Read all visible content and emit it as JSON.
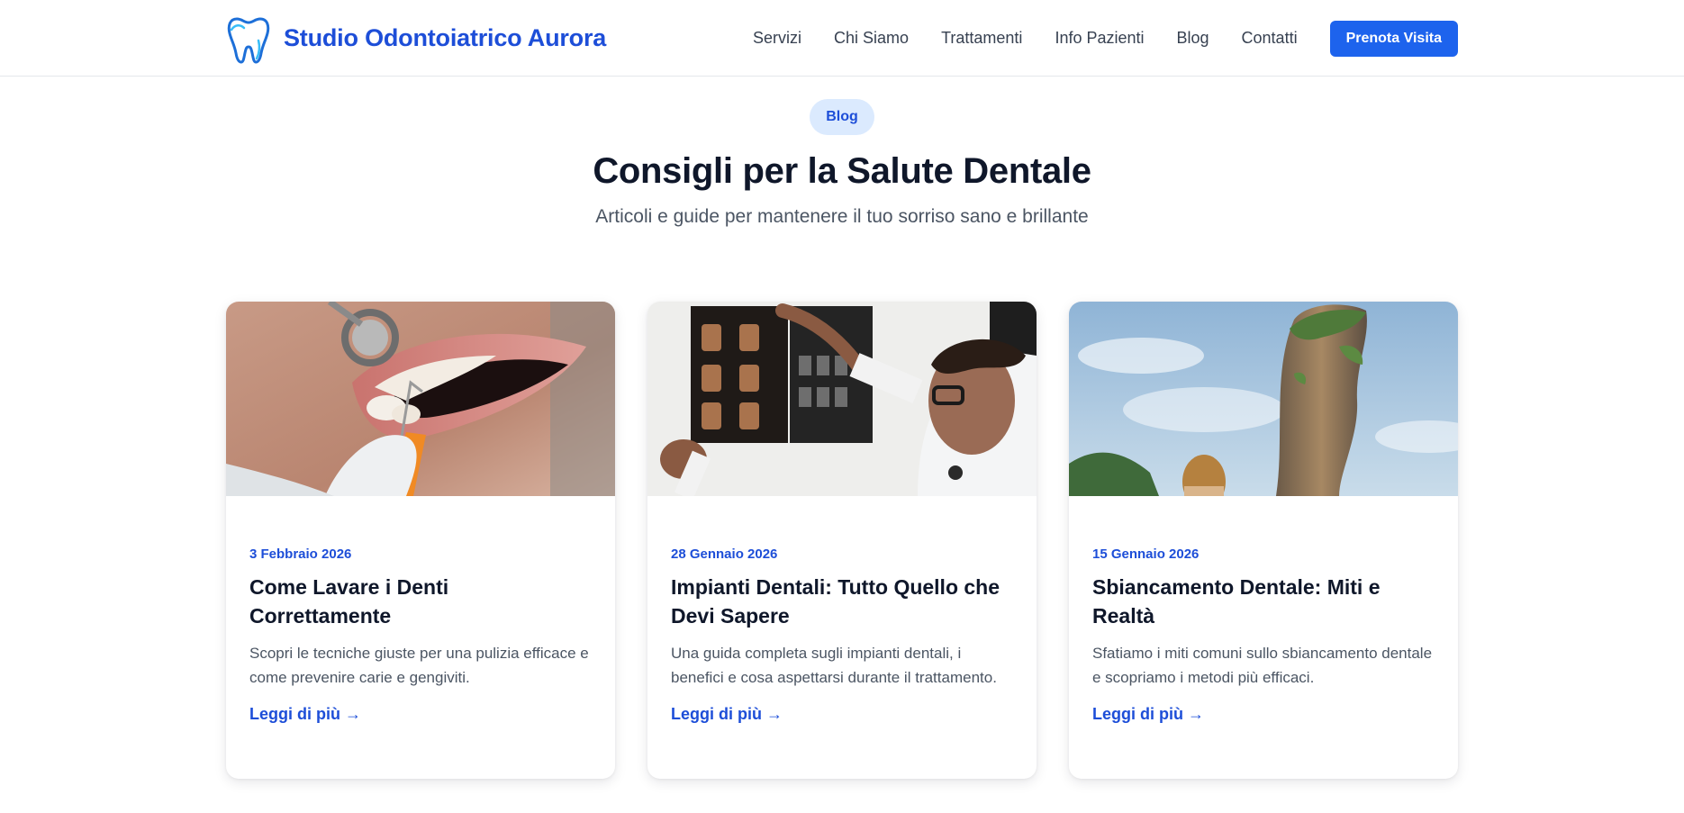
{
  "header": {
    "brand_name": "Studio Odontoiatrico Aurora",
    "logo_icon": "tooth-icon",
    "nav": [
      {
        "label": "Servizi"
      },
      {
        "label": "Chi Siamo"
      },
      {
        "label": "Trattamenti"
      },
      {
        "label": "Info Pazienti"
      },
      {
        "label": "Blog"
      },
      {
        "label": "Contatti"
      }
    ],
    "cta_label": "Prenota Visita"
  },
  "hero": {
    "badge": "Blog",
    "title": "Consigli per la Salute Dentale",
    "subtitle": "Articoli e guide per mantenere il tuo sorriso sano e brillante"
  },
  "articles": [
    {
      "date": "3 Febbraio 2026",
      "title": "Come Lavare i Denti Correttamente",
      "excerpt": "Scopri le tecniche giuste per una pulizia efficace e come prevenire carie e gengiviti.",
      "link": "Leggi di più →",
      "image": "dental-checkup-photo"
    },
    {
      "date": "28 Gennaio 2026",
      "title": "Impianti Dentali: Tutto Quello che Devi Sapere",
      "excerpt": "Una guida completa sugli impianti dentali, i benefici e cosa aspettarsi durante il trattamento.",
      "link": "Leggi di più →",
      "image": "dentist-xray-photo"
    },
    {
      "date": "15 Gennaio 2026",
      "title": "Sbiancamento Dentale: Miti e Realtà",
      "excerpt": "Sfatiamo i miti comuni sullo sbiancamento dentale e scopriamo i metodi più efficaci.",
      "link": "Leggi di più →",
      "image": "rock-island-photo"
    }
  ],
  "colors": {
    "brand": "#1d4ed8",
    "cta_bg": "#1d63ed",
    "badge_bg": "#dbeafe",
    "heading": "#0f172a",
    "body_text": "#4b5563"
  }
}
